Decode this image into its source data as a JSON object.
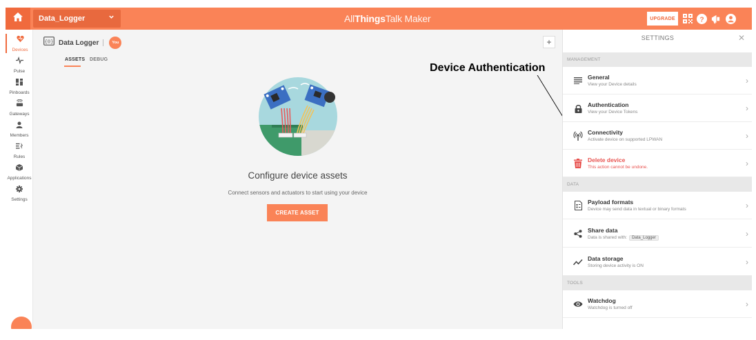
{
  "topbar": {
    "device_name": "Data_Logger",
    "brand_part1": "All",
    "brand_part2": "Things",
    "brand_part3": "Talk",
    "brand_part4": " Maker",
    "upgrade_label": "UPGRADE"
  },
  "nav": {
    "items": [
      {
        "label": "Devices",
        "icon": "device-heart-icon"
      },
      {
        "label": "Pulse",
        "icon": "pulse-icon"
      },
      {
        "label": "Pinboards",
        "icon": "pinboard-icon"
      },
      {
        "label": "Gateways",
        "icon": "gateway-icon"
      },
      {
        "label": "Members",
        "icon": "person-icon"
      },
      {
        "label": "Rules",
        "icon": "rules-icon"
      },
      {
        "label": "Applications",
        "icon": "cube-icon"
      },
      {
        "label": "Settings",
        "icon": "gear-icon"
      }
    ]
  },
  "main": {
    "device_title": "Data Logger",
    "you_badge": "You",
    "tab_assets": "ASSETS",
    "tab_debug": "DEBUG",
    "configure_title": "Configure device assets",
    "configure_sub": "Connect sensors and actuators to start using your device",
    "create_button": "CREATE ASSET"
  },
  "annotation": {
    "label": "Device Authentication"
  },
  "settings": {
    "title": "SETTINGS",
    "section_management": "MANAGEMENT",
    "section_data": "DATA",
    "section_tools": "TOOLS",
    "rows": {
      "general": {
        "title": "General",
        "sub": "View your Device details"
      },
      "authentication": {
        "title": "Authentication",
        "sub": "View your Device Tokens"
      },
      "connectivity": {
        "title": "Connectivity",
        "sub": "Activate device on supported LPWAN"
      },
      "delete": {
        "title": "Delete device",
        "sub": "This action cannot be undone."
      },
      "payload": {
        "title": "Payload formats",
        "sub": "Device may send data in textual or binary formats"
      },
      "share": {
        "title": "Share data",
        "sub": "Data is shared with:",
        "chip": "Data_Logger"
      },
      "storage": {
        "title": "Data storage",
        "sub": "Storing device activity is ON"
      },
      "watchdog": {
        "title": "Watchdog",
        "sub": "Watchdog is turned off"
      }
    }
  },
  "colors": {
    "accent": "#fa8357",
    "accent_dark": "#f06a3d",
    "danger": "#e8524f"
  }
}
